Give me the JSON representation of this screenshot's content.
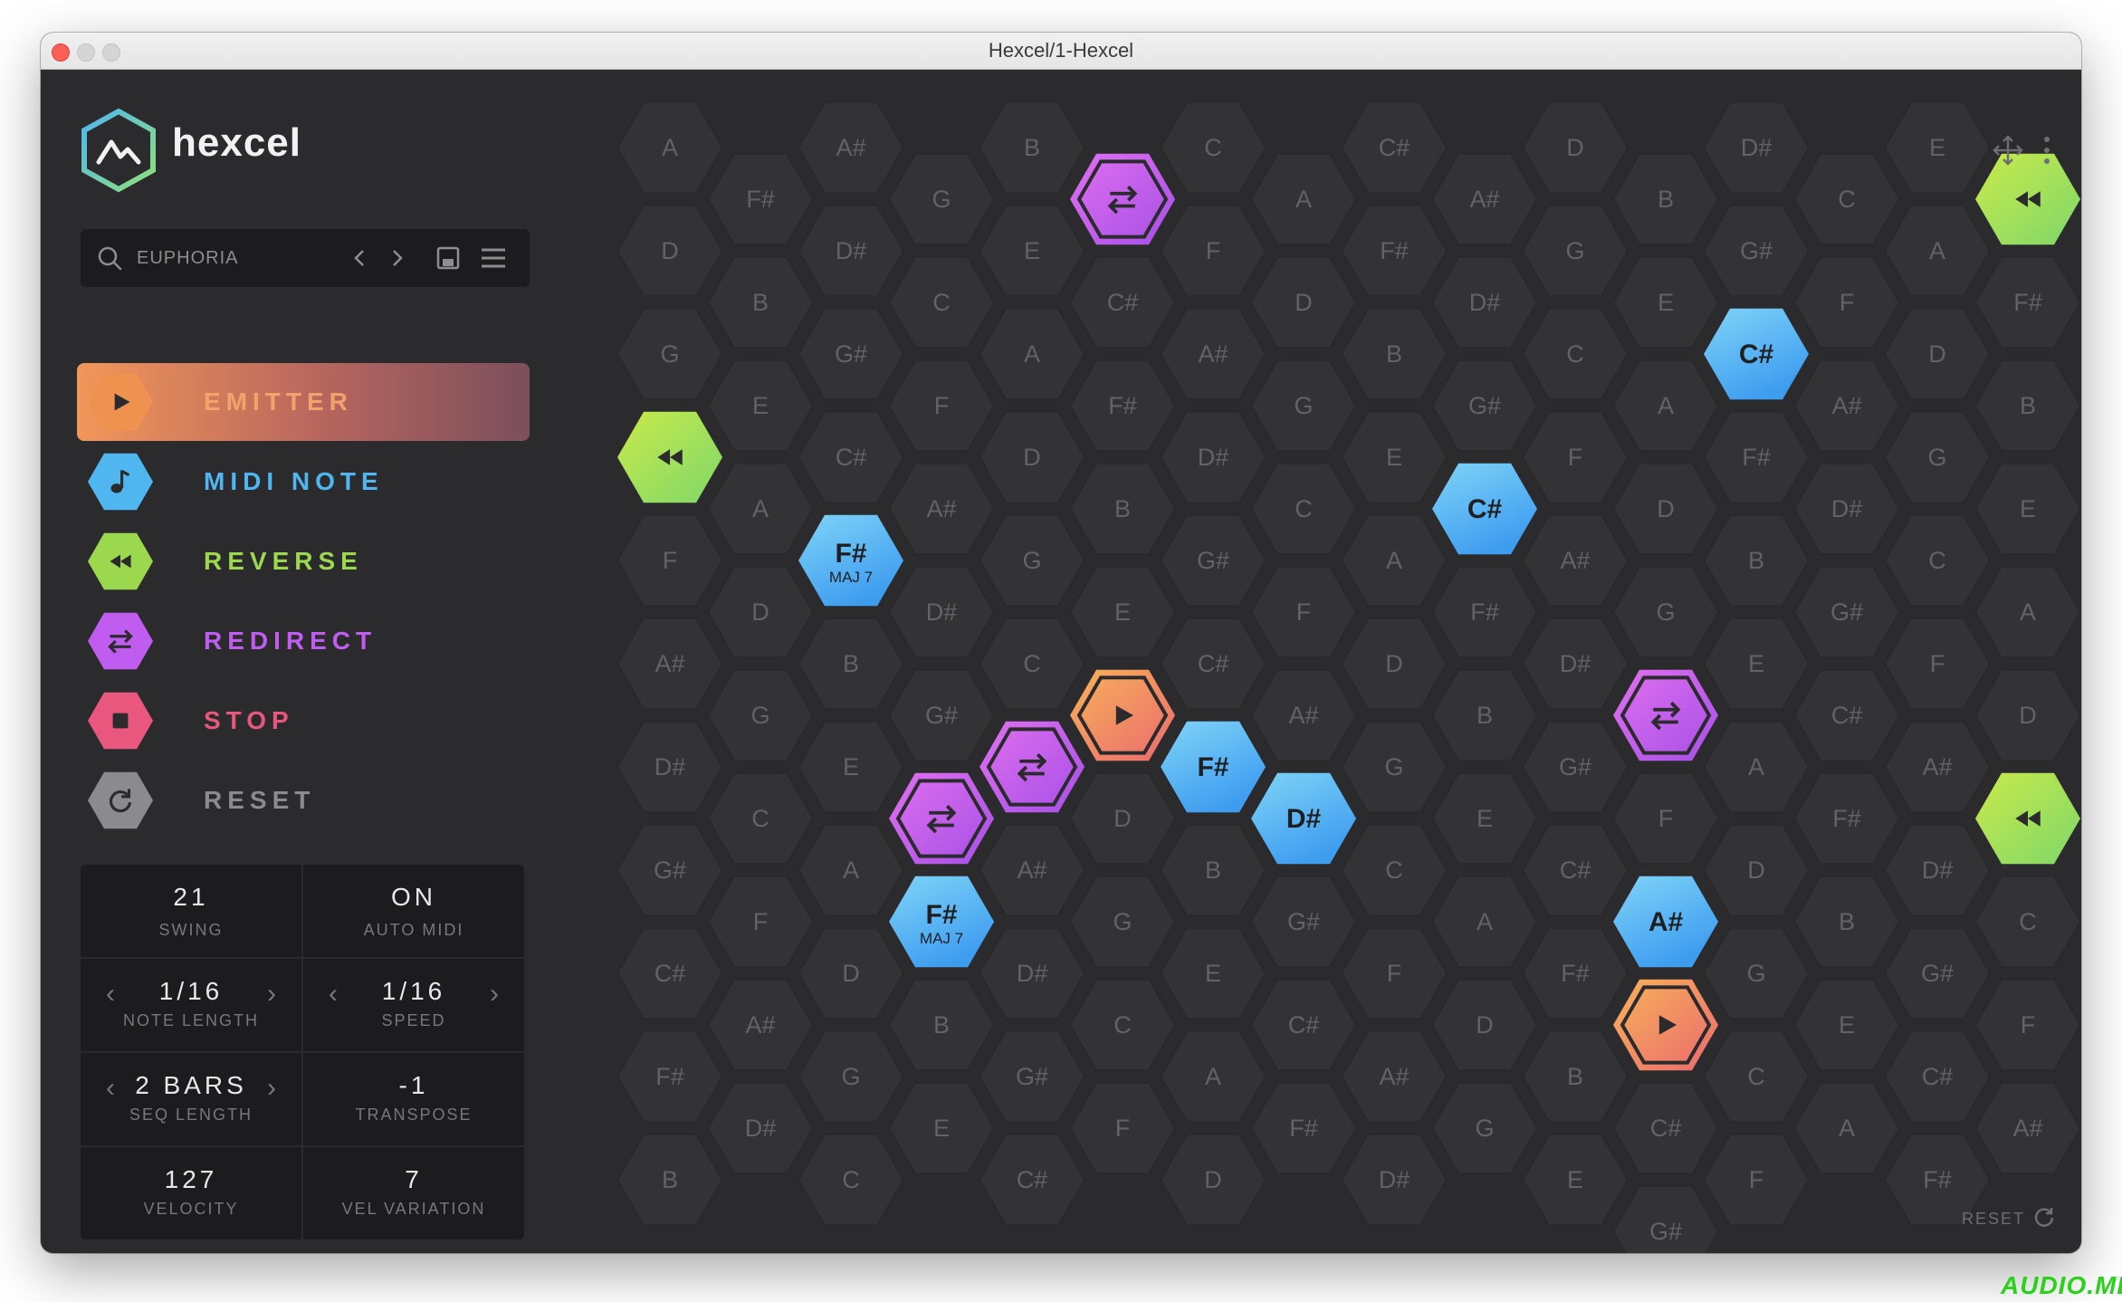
{
  "window": {
    "title": "Hexcel/1-Hexcel"
  },
  "brand": {
    "name": "hexcel"
  },
  "preset": {
    "name": "EUPHORIA"
  },
  "tools": [
    {
      "id": "emitter",
      "label": "EMITTER",
      "color": "#f0924f",
      "icon": "play-icon",
      "active": true
    },
    {
      "id": "midi-note",
      "label": "MIDI NOTE",
      "color": "#4fb6f0",
      "icon": "note-icon",
      "active": false
    },
    {
      "id": "reverse",
      "label": "REVERSE",
      "color": "#9bd84e",
      "icon": "rewind-icon",
      "active": false
    },
    {
      "id": "redirect",
      "label": "REDIRECT",
      "color": "#c05df0",
      "icon": "redirect-icon",
      "active": false
    },
    {
      "id": "stop",
      "label": "STOP",
      "color": "#e9577f",
      "icon": "stop-icon",
      "active": false
    },
    {
      "id": "reset",
      "label": "RESET",
      "color": "#8a8a8f",
      "icon": "reset-icon",
      "active": false
    }
  ],
  "params": {
    "swing": {
      "value": "21",
      "label": "SWING"
    },
    "auto_midi": {
      "value": "ON",
      "label": "AUTO MIDI"
    },
    "note_length": {
      "value": "1/16",
      "label": "NOTE LENGTH"
    },
    "speed": {
      "value": "1/16",
      "label": "SPEED"
    },
    "seq_length": {
      "value": "2 BARS",
      "label": "SEQ LENGTH"
    },
    "transpose": {
      "value": "-1",
      "label": "TRANSPOSE"
    },
    "velocity": {
      "value": "127",
      "label": "VELOCITY"
    },
    "vel_variation": {
      "value": "7",
      "label": "VEL VARIATION"
    }
  },
  "grid": {
    "column_notes": [
      [
        "A",
        "D",
        "G",
        "",
        "F",
        "A#",
        "D#",
        "G#",
        "C#",
        "F#",
        "B"
      ],
      [
        "F#",
        "B",
        "E",
        "A",
        "D",
        "G",
        "C",
        "F",
        "A#",
        "D#"
      ],
      [
        "A#",
        "D#",
        "G#",
        "C#",
        "",
        "B",
        "E",
        "A",
        "D",
        "G",
        "C"
      ],
      [
        "G",
        "C",
        "F",
        "A#",
        "D#",
        "G#",
        "",
        "F#",
        "B",
        "E"
      ],
      [
        "B",
        "E",
        "A",
        "D",
        "G",
        "C",
        "",
        "A#",
        "D#",
        "G#",
        "C#"
      ],
      [
        "",
        "C#",
        "F#",
        "B",
        "E",
        "",
        "D",
        "G",
        "C",
        "F"
      ],
      [
        "C",
        "F",
        "A#",
        "D#",
        "G#",
        "C#",
        "F#",
        "B",
        "E",
        "A",
        "D"
      ],
      [
        "A",
        "D",
        "G",
        "C",
        "F",
        "A#",
        "",
        "G#",
        "C#",
        "F#"
      ],
      [
        "C#",
        "F#",
        "B",
        "E",
        "A",
        "D",
        "G",
        "C",
        "F",
        "A#",
        "D#"
      ],
      [
        "A#",
        "D#",
        "G#",
        "",
        "F#",
        "B",
        "E",
        "A",
        "D",
        "G"
      ],
      [
        "D",
        "G",
        "C",
        "F",
        "A#",
        "D#",
        "G#",
        "C#",
        "F#",
        "B",
        "E"
      ],
      [
        "B",
        "E",
        "A",
        "D",
        "G",
        "",
        "F",
        "",
        "",
        "C#",
        "G#"
      ],
      [
        "D#",
        "G#",
        "",
        "F#",
        "B",
        "E",
        "A",
        "D",
        "G",
        "C",
        "F"
      ],
      [
        "C",
        "F",
        "A#",
        "D#",
        "G#",
        "C#",
        "F#",
        "B",
        "E",
        "A"
      ],
      [
        "E",
        "A",
        "D",
        "G",
        "C",
        "F",
        "A#",
        "D#",
        "G#",
        "C#",
        "F#"
      ],
      [
        "",
        "F#",
        "B",
        "E",
        "A",
        "D",
        "",
        "C",
        "F",
        "A#"
      ]
    ],
    "special_cells": [
      {
        "col": 0,
        "row": 3,
        "kind": "reverse"
      },
      {
        "col": 2,
        "row": 4,
        "kind": "note",
        "label": "F#",
        "sub": "MAJ 7"
      },
      {
        "col": 3,
        "row": 6,
        "kind": "redirect"
      },
      {
        "col": 3,
        "row": 7,
        "kind": "note",
        "label": "F#",
        "sub": "MAJ 7"
      },
      {
        "col": 4,
        "row": 6,
        "kind": "redirect"
      },
      {
        "col": 5,
        "row": 0,
        "kind": "redirect"
      },
      {
        "col": 5,
        "row": 5,
        "kind": "emitter"
      },
      {
        "col": 6,
        "row": 6,
        "kind": "note",
        "label": "F#",
        "sub": ""
      },
      {
        "col": 7,
        "row": 6,
        "kind": "note",
        "label": "D#",
        "sub": ""
      },
      {
        "col": 9,
        "row": 3,
        "kind": "note",
        "label": "C#",
        "sub": ""
      },
      {
        "col": 11,
        "row": 5,
        "kind": "redirect"
      },
      {
        "col": 11,
        "row": 7,
        "kind": "note",
        "label": "A#",
        "sub": ""
      },
      {
        "col": 11,
        "row": 8,
        "kind": "emitter"
      },
      {
        "col": 12,
        "row": 2,
        "kind": "note",
        "label": "C#",
        "sub": ""
      },
      {
        "col": 15,
        "row": 0,
        "kind": "reverse"
      },
      {
        "col": 15,
        "row": 6,
        "kind": "reverse"
      }
    ],
    "reset_label": "RESET"
  },
  "watermark": "AUDIO.ME"
}
